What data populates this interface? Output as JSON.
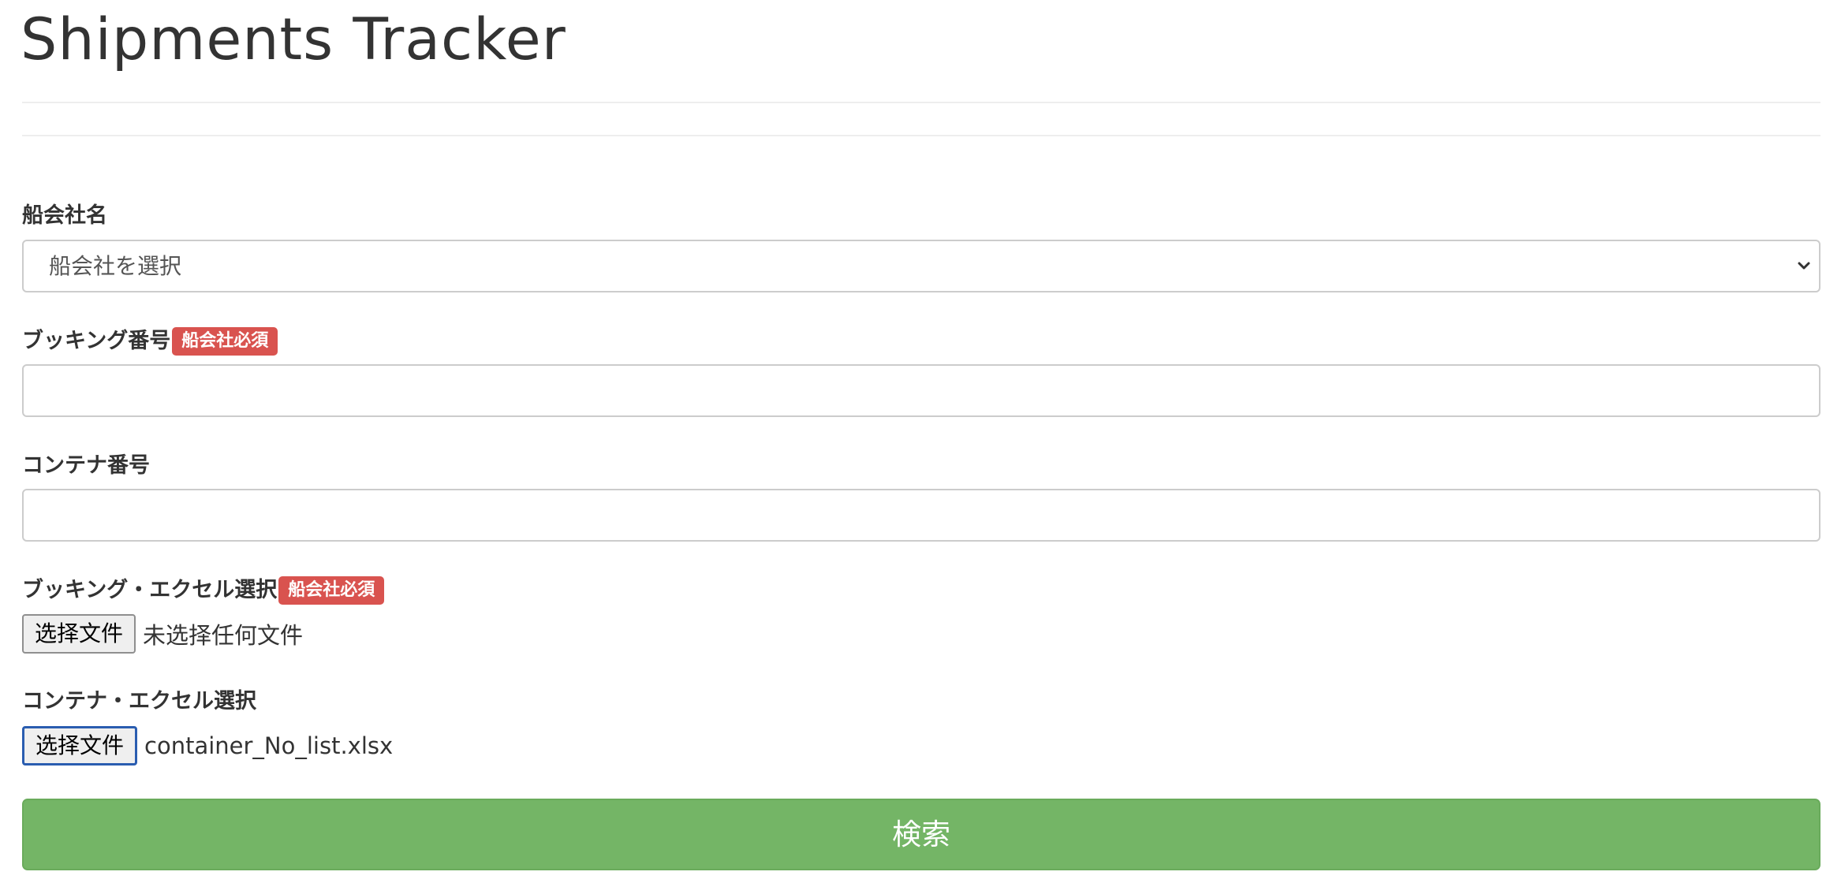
{
  "page": {
    "title": "Shipments Tracker"
  },
  "form": {
    "carrier": {
      "label": "船会社名",
      "selected": "船会社を選択"
    },
    "booking_number": {
      "label": "ブッキング番号",
      "badge": "船会社必須",
      "value": ""
    },
    "container_number": {
      "label": "コンテナ番号",
      "value": ""
    },
    "booking_excel": {
      "label": "ブッキング・エクセル選択",
      "badge": "船会社必須",
      "button_label": "选择文件",
      "file_status": "未选择任何文件"
    },
    "container_excel": {
      "label": "コンテナ・エクセル選択",
      "button_label": "选择文件",
      "file_status": "container_No_list.xlsx"
    },
    "submit_label": "検索"
  },
  "colors": {
    "badge": "#d9534f",
    "submit_button": "#74b566",
    "focus_ring": "#2a5db0"
  },
  "icons": {
    "select_arrow": "chevron-down-icon"
  }
}
